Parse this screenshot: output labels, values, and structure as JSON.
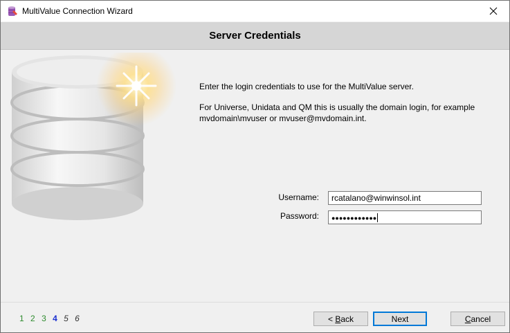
{
  "window": {
    "title": "MultiValue Connection Wizard",
    "close_symbol": "✕"
  },
  "header": {
    "title": "Server Credentials"
  },
  "content": {
    "intro_line1": "Enter the login credentials to use for the MultiValue server.",
    "intro_line2": "For Universe, Unidata and QM this is usually the domain login, for example mvdomain\\mvuser or mvuser@mvdomain.int.",
    "username_label": "Username:",
    "username_value": "rcatalano@winwinsol.int",
    "password_label": "Password:",
    "password_masked": "●●●●●●●●●●●●"
  },
  "footer": {
    "steps": [
      {
        "label": "1",
        "state": "done"
      },
      {
        "label": "2",
        "state": "done"
      },
      {
        "label": "3",
        "state": "done"
      },
      {
        "label": "4",
        "state": "current"
      },
      {
        "label": "5",
        "state": "next"
      },
      {
        "label": "6",
        "state": "next"
      }
    ],
    "back_prefix": "< ",
    "back_accel": "B",
    "back_rest": "ack",
    "next_label": "Next",
    "cancel_accel": "C",
    "cancel_rest": "ancel"
  },
  "colors": {
    "accent": "#0078d7",
    "step_done": "#2e8b2e",
    "step_current": "#1a2fd0"
  },
  "icons": {
    "app": "database-wizard-icon",
    "close": "close-icon",
    "illustration": "database-illustration"
  }
}
